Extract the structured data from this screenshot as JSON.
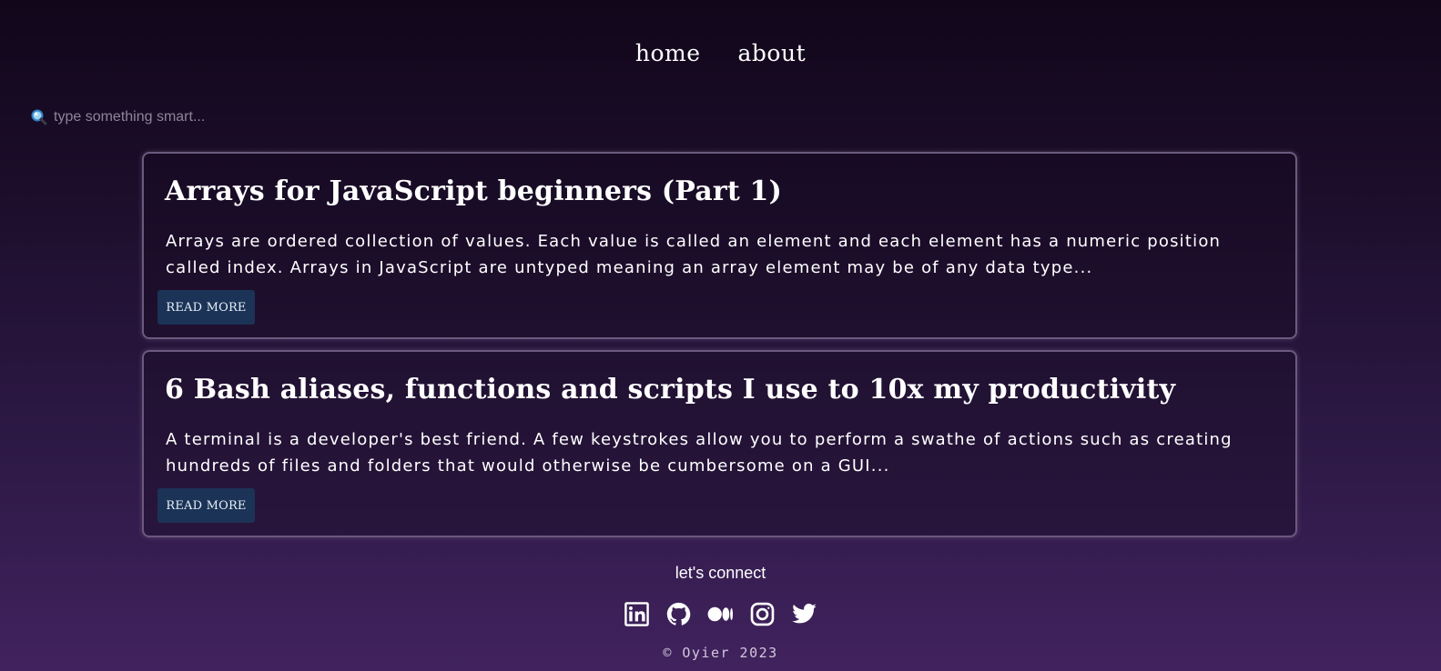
{
  "nav": {
    "home_label": "home",
    "about_label": "about"
  },
  "search": {
    "placeholder": "type something smart...",
    "icon": "magnifying-glass-icon"
  },
  "posts": [
    {
      "title": "Arrays for JavaScript beginners (Part 1)",
      "excerpt": "Arrays are ordered collection of values. Each value is called an element and each element has a numeric position called index. Arrays in JavaScript are untyped meaning an array element may be of any data type...",
      "button_label": "READ MORE"
    },
    {
      "title": "6 Bash aliases, functions and scripts I use to 10x my productivity",
      "excerpt": "A terminal is a developer's best friend. A few keystrokes allow you to perform a swathe of actions such as creating hundreds of files and folders that would otherwise be cumbersome on a GUI...",
      "button_label": "READ MORE"
    }
  ],
  "footer": {
    "connect_label": "let's connect",
    "socials": [
      "linkedin-icon",
      "github-icon",
      "medium-icon",
      "instagram-icon",
      "twitter-icon"
    ],
    "copyright": "© Oyier 2023"
  },
  "colors": {
    "background_top": "#11061a",
    "background_bottom": "#41225e",
    "card_border": "#6c5a7e",
    "button_bg": "#1b3356"
  }
}
